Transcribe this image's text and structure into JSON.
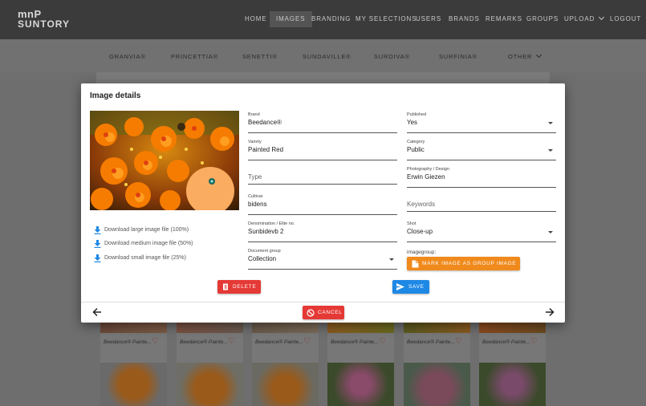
{
  "app": {
    "logo_line1": "mnP",
    "logo_line2": "SUNTORY",
    "nav": [
      "HOME",
      "IMAGES",
      "BRANDING",
      "MY SELECTIONS",
      "USERS",
      "BRANDS",
      "REMARKS",
      "GROUPS",
      "UPLOAD",
      "LOGOUT"
    ],
    "active_nav": "IMAGES",
    "subnav": [
      "GRANVIA®",
      "PRINCETTIA®",
      "SENETTI®",
      "SUNDAVILLE®",
      "SURDIVA®",
      "SURFINIA®",
      "OTHER"
    ],
    "card_caption": "Beedance® Painte..."
  },
  "modal": {
    "title": "Image details",
    "downloads": [
      "Download large image file (100%)",
      "Download medium image file (50%)",
      "Download small image file (25%)"
    ],
    "fields": {
      "brand": {
        "label": "Brand",
        "value": "Beedance®"
      },
      "variety": {
        "label": "Variety",
        "value": "Painted Red"
      },
      "type": {
        "placeholder": "Type"
      },
      "cultivar": {
        "label": "Cultivar",
        "value": "bidens"
      },
      "denomination": {
        "label": "Denomination / Elite no.",
        "value": "Sunbidevb 2"
      },
      "document_group": {
        "label": "Document group",
        "value": "Collection"
      },
      "published": {
        "label": "Published",
        "value": "Yes"
      },
      "category": {
        "label": "Category",
        "value": "Public"
      },
      "photography": {
        "label": "Photography / Design",
        "value": "Erwin Giezen"
      },
      "keywords": {
        "placeholder": "Keywords"
      },
      "shot": {
        "label": "Shot",
        "value": "Close-up"
      }
    },
    "imagegroup_label": "imagegroup:",
    "mark_button": "MARK IMAGE AS GROUP IMAGE",
    "delete_button": "DELETE",
    "save_button": "SAVE",
    "cancel_button": "CANCEL"
  },
  "colors": {
    "orange": "#f08a1c",
    "red": "#e53935",
    "blue": "#1e88e5",
    "header": "#3b3b3b"
  }
}
